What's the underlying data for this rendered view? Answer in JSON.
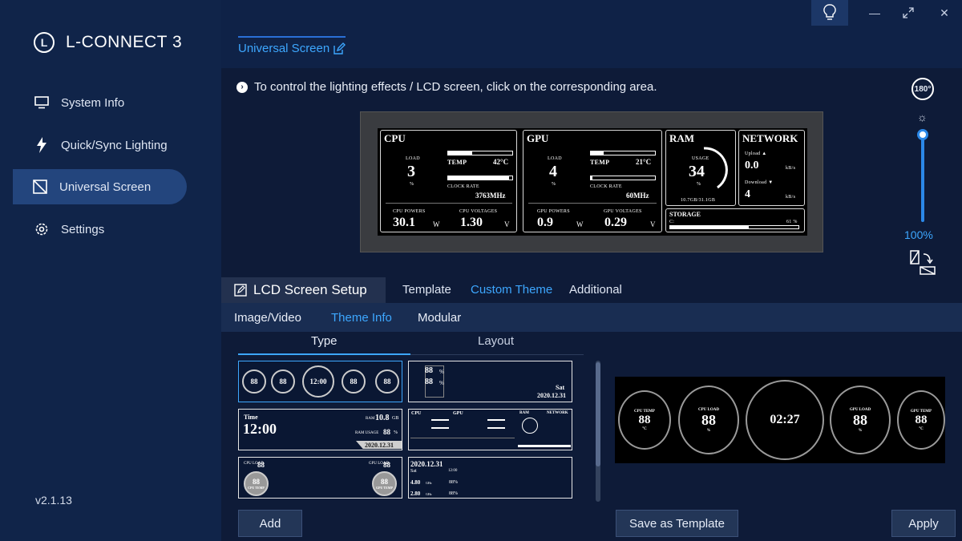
{
  "app": {
    "name": "L-CONNECT 3",
    "version": "v2.1.13"
  },
  "sidebar": {
    "items": [
      {
        "label": "System Info",
        "icon": "monitor-icon"
      },
      {
        "label": "Quick/Sync Lighting",
        "icon": "lightning-icon"
      },
      {
        "label": "Universal Screen",
        "icon": "screen-icon",
        "active": true
      },
      {
        "label": "Settings",
        "icon": "gear-icon"
      }
    ]
  },
  "header": {
    "page_tab": "Universal Screen",
    "hint": "To control the lighting effects / LCD screen, click on the corresponding area."
  },
  "lcd": {
    "cpu": {
      "title": "CPU",
      "load_label": "LOAD",
      "load": "3",
      "load_unit": "%",
      "temp_label": "TEMP",
      "temp": "42°C",
      "clock_label": "CLOCK RATE",
      "clock": "3763MHz",
      "powers_label": "CPU POWERS",
      "powers": "30.1",
      "powers_unit": "W",
      "volt_label": "CPU VOLTAGES",
      "volt": "1.30",
      "volt_unit": "V"
    },
    "gpu": {
      "title": "GPU",
      "load_label": "LOAD",
      "load": "4",
      "load_unit": "%",
      "temp_label": "TEMP",
      "temp": "21°C",
      "clock_label": "CLOCK RATE",
      "clock": "60MHz",
      "powers_label": "GPU POWERS",
      "powers": "0.9",
      "powers_unit": "W",
      "volt_label": "GPU VOLTAGES",
      "volt": "0.29",
      "volt_unit": "V"
    },
    "ram": {
      "title": "RAM",
      "usage_label": "USAGE",
      "usage": "34",
      "unit": "%",
      "mem": "10.7GB/31.1GB"
    },
    "network": {
      "title": "NETWORK",
      "up_label": "Upload ▲",
      "up": "0.0",
      "up_unit": "kB/s",
      "down_label": "Download ▼",
      "down": "4",
      "down_unit": "kB/s"
    },
    "storage": {
      "title": "STORAGE",
      "drive": "C:",
      "pct": "61 %"
    }
  },
  "controls": {
    "rotate_label": "180°",
    "brightness": "100%"
  },
  "tabs": {
    "lcd_setup": "LCD Screen Setup",
    "template": "Template",
    "custom_theme": "Custom Theme",
    "additional": "Additional"
  },
  "subtabs": {
    "image_video": "Image/Video",
    "theme_info": "Theme Info",
    "modular": "Modular"
  },
  "columns": {
    "type": "Type",
    "layout": "Layout"
  },
  "cards": {
    "c1": {
      "g1": "88",
      "g2": "88",
      "clock": "12:00",
      "g4": "88",
      "g5": "88"
    },
    "c2": {
      "v1": "88",
      "unit1": "%",
      "v2": "88",
      "unit2": "%",
      "date": "Sat",
      "date2": "2020.12.31"
    },
    "c3": {
      "label": "Time",
      "time": "12:00",
      "ram_label": "RAM",
      "ram": "10.8",
      "ram_unit": "GB",
      "usage_label": "RAM USAGE",
      "usage": "88",
      "usage_unit": "%",
      "date": "2020.12.31"
    },
    "c5": {
      "cpu_label": "CPU LOAD",
      "cpu": "88",
      "unit": "%",
      "gauge": "88",
      "gauge_label": "CPU TEMP",
      "gpu_label": "GPU LOAD",
      "gpu": "88",
      "gauge2": "88",
      "gauge2_label": "GPU TEMP"
    },
    "c6": {
      "date": "2020.12.31",
      "day": "Sat",
      "time": "12:00",
      "v1": "4.80",
      "u1": "GHz",
      "p1": "88%",
      "v2": "2.80",
      "u2": "GHz",
      "p2": "88%"
    }
  },
  "preview": {
    "g1_label": "CPU TEMP",
    "g1": "88",
    "g1_unit": "°C",
    "g2_label": "CPU LOAD",
    "g2": "88",
    "g2_unit": "%",
    "clock": "02:27",
    "g4_label": "GPU LOAD",
    "g4": "88",
    "g4_unit": "%",
    "g5_label": "GPU TEMP",
    "g5": "88",
    "g5_unit": "°C"
  },
  "buttons": {
    "add": "Add",
    "save_template": "Save as Template",
    "apply": "Apply"
  }
}
